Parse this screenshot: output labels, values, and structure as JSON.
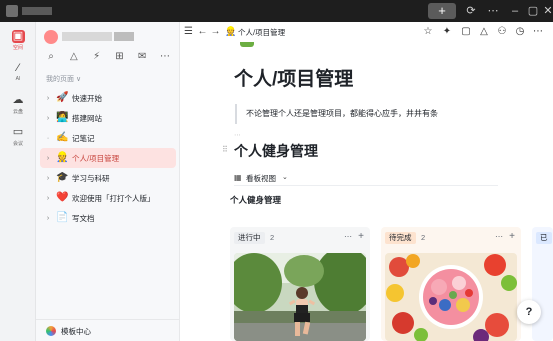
{
  "titlebar": {
    "new_tab_label": "+",
    "controls": [
      "sync-icon",
      "more-icon",
      "minimize-icon",
      "maximize-icon",
      "close-icon"
    ]
  },
  "rail": [
    {
      "icon": "space-icon",
      "label": "空间",
      "active": true
    },
    {
      "icon": "ai-icon",
      "label": "AI",
      "active": false
    },
    {
      "icon": "cloud-icon",
      "label": "云盘",
      "active": false
    },
    {
      "icon": "meeting-icon",
      "label": "会议",
      "active": false
    }
  ],
  "sidebar": {
    "tools": [
      "search-icon",
      "share-icon",
      "ai-spark-icon",
      "template-icon",
      "inbox-icon",
      "more-icon"
    ],
    "section_label": "我的页面",
    "section_chevron": "∨",
    "items": [
      {
        "label": "快速开始",
        "emoji": "🚀",
        "has_children": true,
        "active": false
      },
      {
        "label": "搭建网站",
        "emoji": "👩‍💻",
        "has_children": true,
        "active": false
      },
      {
        "label": "记笔记",
        "emoji": "✍️",
        "has_children": false,
        "active": false
      },
      {
        "label": "个人/项目管理",
        "emoji": "👷",
        "has_children": true,
        "active": true
      },
      {
        "label": "学习与科研",
        "emoji": "🎓",
        "has_children": true,
        "active": false
      },
      {
        "label": "欢迎使用「打打个人版」",
        "emoji": "❤️",
        "has_children": true,
        "active": false
      },
      {
        "label": "写文档",
        "emoji": "📄",
        "has_children": true,
        "active": false
      }
    ],
    "footer_label": "模板中心"
  },
  "topbar": {
    "breadcrumb_emoji": "👷",
    "breadcrumb": "个人/项目管理",
    "nav_icons": [
      "menu-icon",
      "back-arrow-icon",
      "forward-arrow-icon"
    ],
    "right_icons": [
      "star-icon",
      "ai-spark-icon",
      "comment-icon",
      "share-icon",
      "add-user-icon",
      "history-icon",
      "more-icon"
    ]
  },
  "page": {
    "title": "个人/项目管理",
    "quote": "不论管理个人还是管理项目，都能得心应手，井井有条",
    "dots": "⋯",
    "heading": "个人健身管理",
    "view_label": "看板视图",
    "database_title": "个人健身管理"
  },
  "board": {
    "columns": [
      {
        "tag": "进行中",
        "count": "2",
        "tag_color": "#eceef1",
        "bg": "#f5f6f7",
        "image": "running-woman-photo"
      },
      {
        "tag": "待完成",
        "count": "2",
        "tag_color": "#fde3cf",
        "bg": "#fdf6ef",
        "image": "fruit-bowl-photo"
      },
      {
        "tag": "已",
        "count": "",
        "tag_color": "#dbe8ff",
        "bg": "#f2f6ff",
        "image": ""
      }
    ]
  },
  "help_label": "?"
}
